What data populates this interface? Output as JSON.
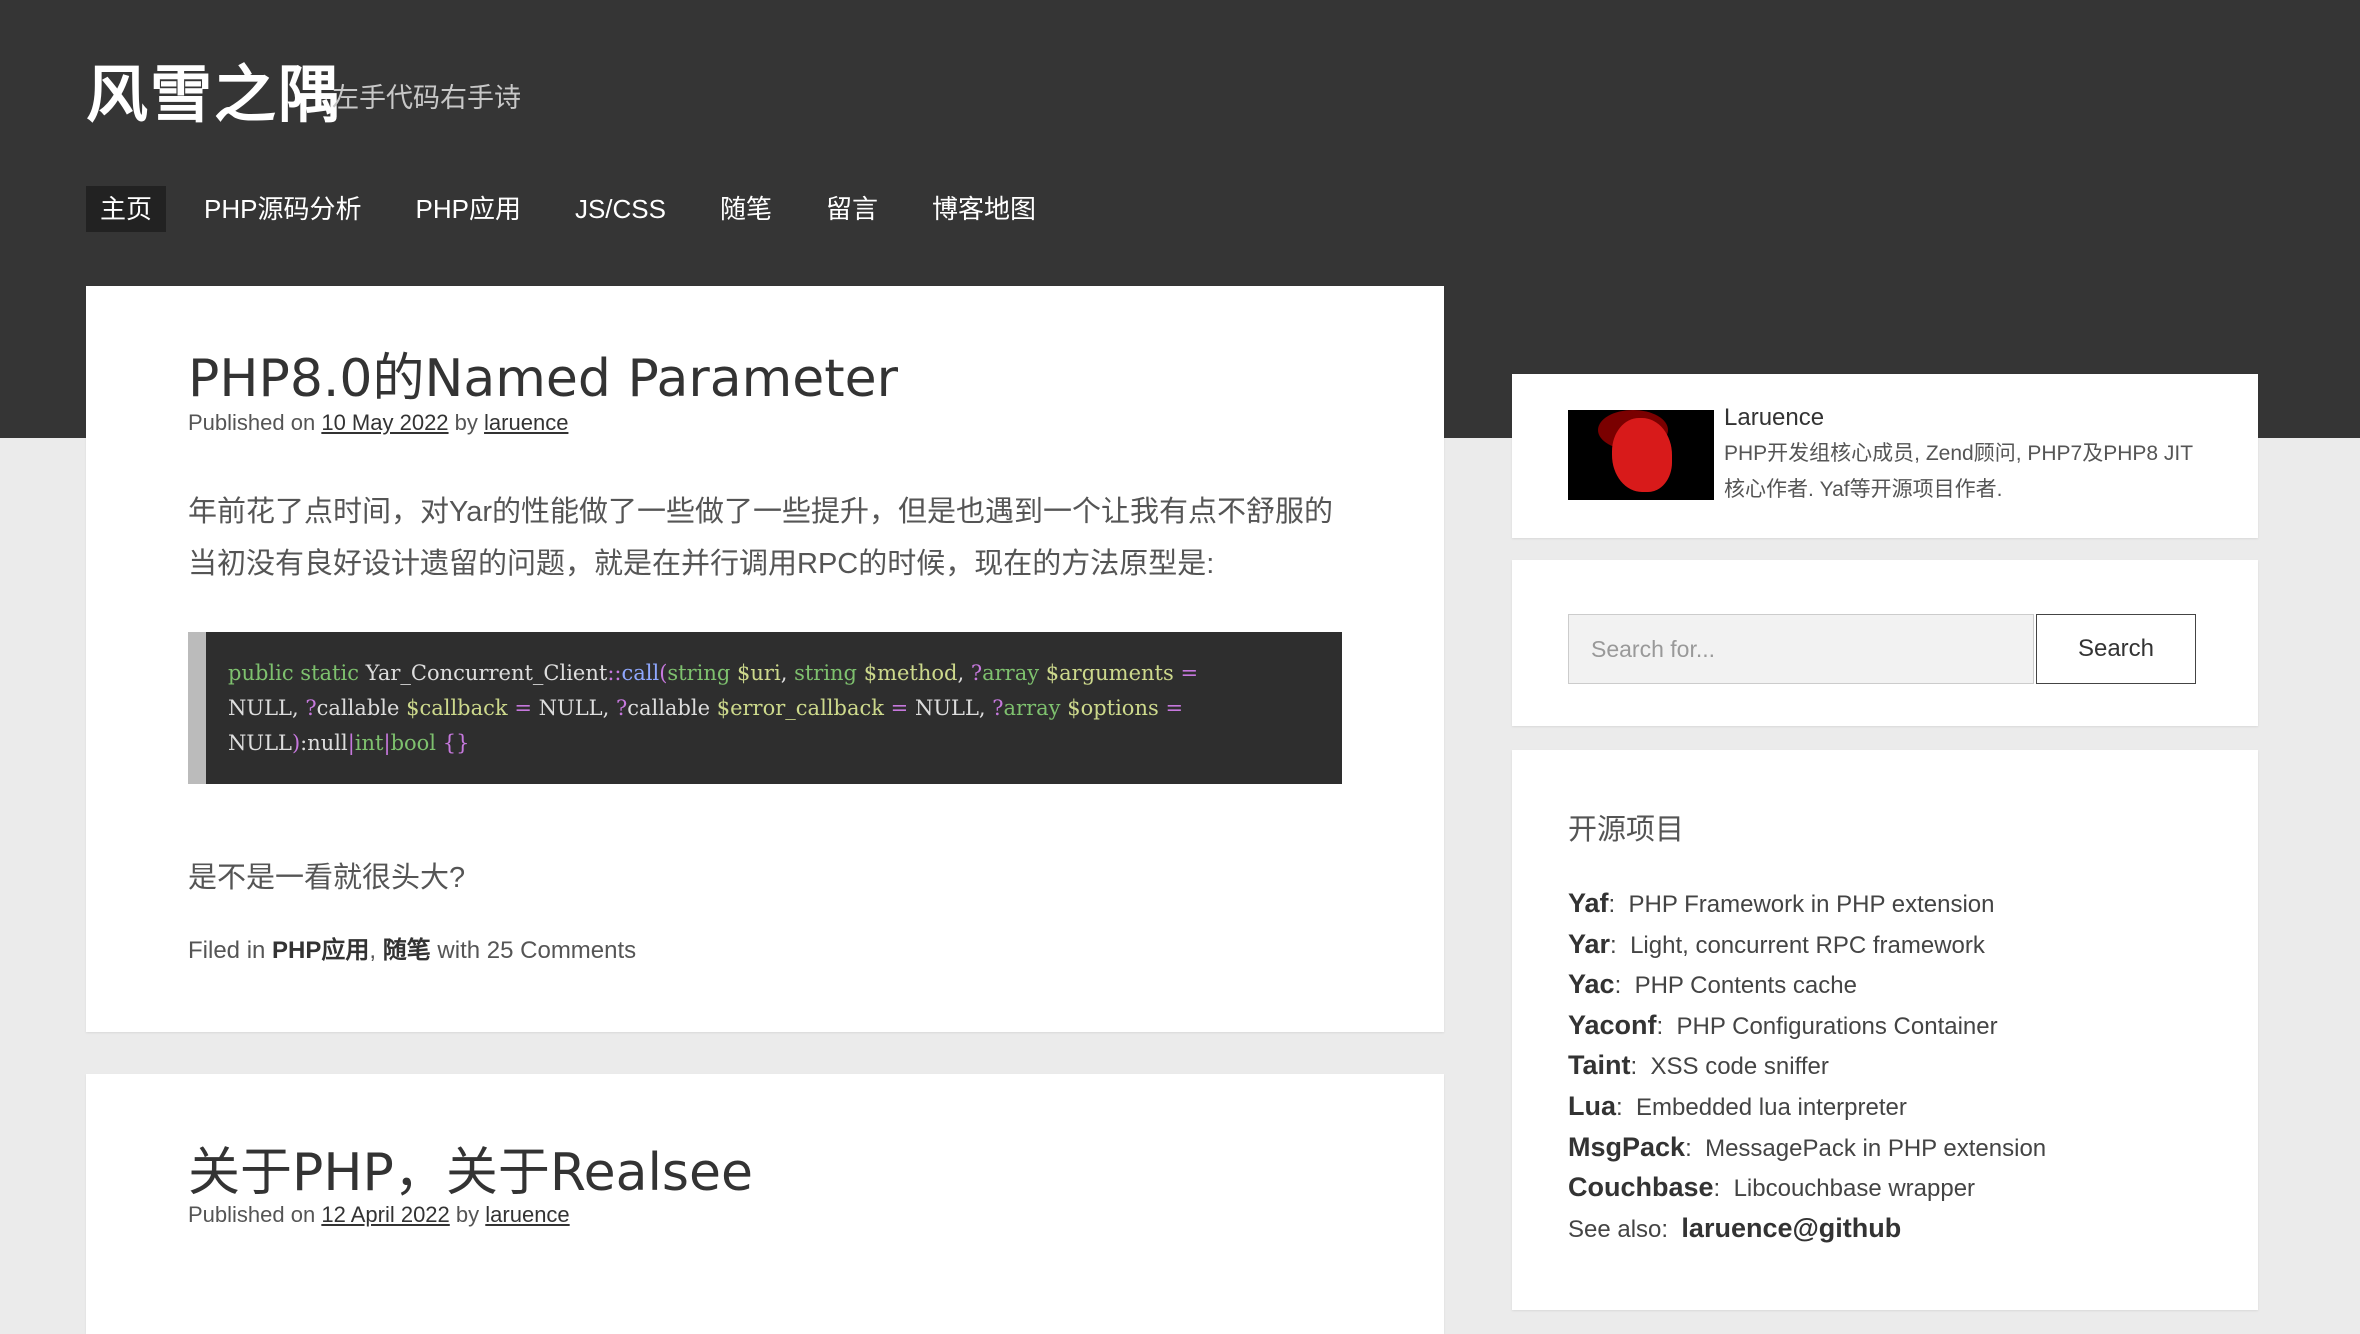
{
  "site": {
    "title": "风雪之隅",
    "description": "左手代码右手诗"
  },
  "nav": {
    "items": [
      "主页",
      "PHP源码分析",
      "PHP应用",
      "JS/CSS",
      "随笔",
      "留言",
      "博客地图"
    ],
    "active": "主页"
  },
  "posts": [
    {
      "title": "PHP8.0的Named Parameter",
      "published_prefix": "Published on",
      "date": "10 May 2022",
      "by": "by",
      "author": "laruence",
      "paragraph_line1": "年前花了点时间，对Yar的性能做了一些做了一些提升，但是也遇到一个让我有点不舒服的",
      "paragraph_line2": "当初没有良好设计遗留的问题，就是在并行调用RPC的时候，现在的方法原型是:",
      "after_code": "是不是一看就很头大?",
      "filed_prefix": "Filed in",
      "category1": "PHP应用",
      "category_sep": ",",
      "category2": "随笔",
      "comments": "with 25 Comments"
    },
    {
      "title": "关于PHP，关于Realsee",
      "published_prefix": "Published on",
      "date": "12 April 2022",
      "by": "by",
      "author": "laruence"
    }
  ],
  "sidebar": {
    "author": {
      "name": "Laruence",
      "bio": "PHP开发组核心成员, Zend顾问, PHP7及PHP8 JIT核心作者. Yaf等开源项目作者."
    },
    "search": {
      "placeholder": "Search for...",
      "button_label": "Search"
    },
    "projects": {
      "title": "开源项目",
      "items": [
        {
          "name": "Yaf",
          "desc": "PHP Framework in PHP extension"
        },
        {
          "name": "Yar",
          "desc": "Light, concurrent RPC framework"
        },
        {
          "name": "Yac",
          "desc": "PHP Contents cache"
        },
        {
          "name": "Yaconf",
          "desc": "PHP Configurations Container"
        },
        {
          "name": "Taint",
          "desc": "XSS code sniffer"
        },
        {
          "name": "Lua",
          "desc": "Embedded lua interpreter"
        },
        {
          "name": "MsgPack",
          "desc": "MessagePack in PHP extension"
        },
        {
          "name": "Couchbase",
          "desc": "Libcouchbase wrapper"
        }
      ],
      "see_also_label": "See also:",
      "see_also_link": "laruence@github"
    }
  }
}
